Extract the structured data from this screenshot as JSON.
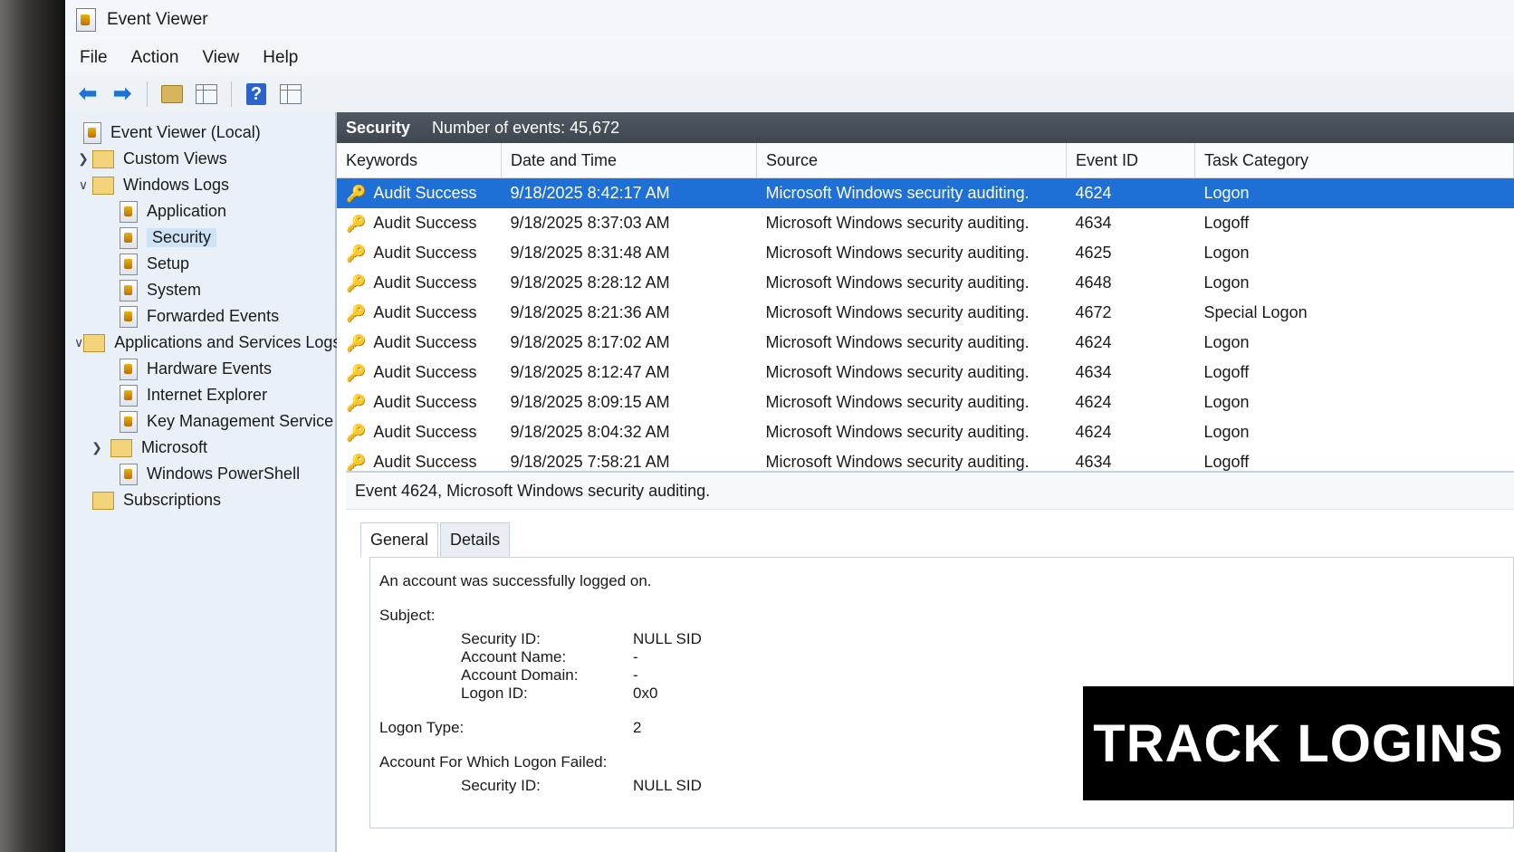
{
  "window": {
    "title": "Event Viewer"
  },
  "menu": [
    {
      "label": "File"
    },
    {
      "label": "Action"
    },
    {
      "label": "View"
    },
    {
      "label": "Help"
    }
  ],
  "sidebar": {
    "items": [
      {
        "label": "Event Viewer (Local)"
      },
      {
        "label": "Custom Views"
      },
      {
        "label": "Windows Logs"
      },
      {
        "label": "Application"
      },
      {
        "label": "Security"
      },
      {
        "label": "Setup"
      },
      {
        "label": "System"
      },
      {
        "label": "Forwarded Events"
      },
      {
        "label": "Applications and Services Logs"
      },
      {
        "label": "Hardware Events"
      },
      {
        "label": "Internet Explorer"
      },
      {
        "label": "Key Management Service"
      },
      {
        "label": "Microsoft"
      },
      {
        "label": "Windows PowerShell"
      },
      {
        "label": "Subscriptions"
      }
    ]
  },
  "log": {
    "name": "Security",
    "count_text": "Number of events: 45,672"
  },
  "table": {
    "columns": [
      "Keywords",
      "Date and Time",
      "Source",
      "Event ID",
      "Task Category"
    ],
    "rows": [
      {
        "keywords": "Audit Success",
        "datetime": "9/18/2025 8:42:17 AM",
        "source": "Microsoft Windows security auditing.",
        "event_id": "4624",
        "task": "Logon"
      },
      {
        "keywords": "Audit Success",
        "datetime": "9/18/2025 8:37:03 AM",
        "source": "Microsoft Windows security auditing.",
        "event_id": "4634",
        "task": "Logoff"
      },
      {
        "keywords": "Audit Success",
        "datetime": "9/18/2025 8:31:48 AM",
        "source": "Microsoft Windows security auditing.",
        "event_id": "4625",
        "task": "Logon"
      },
      {
        "keywords": "Audit Success",
        "datetime": "9/18/2025 8:28:12 AM",
        "source": "Microsoft Windows security auditing.",
        "event_id": "4648",
        "task": "Logon"
      },
      {
        "keywords": "Audit Success",
        "datetime": "9/18/2025 8:21:36 AM",
        "source": "Microsoft Windows security auditing.",
        "event_id": "4672",
        "task": "Special Logon"
      },
      {
        "keywords": "Audit Success",
        "datetime": "9/18/2025 8:17:02 AM",
        "source": "Microsoft Windows security auditing.",
        "event_id": "4624",
        "task": "Logon"
      },
      {
        "keywords": "Audit Success",
        "datetime": "9/18/2025 8:12:47 AM",
        "source": "Microsoft Windows security auditing.",
        "event_id": "4634",
        "task": "Logoff"
      },
      {
        "keywords": "Audit Success",
        "datetime": "9/18/2025 8:09:15 AM",
        "source": "Microsoft Windows security auditing.",
        "event_id": "4624",
        "task": "Logon"
      },
      {
        "keywords": "Audit Success",
        "datetime": "9/18/2025 8:04:32 AM",
        "source": "Microsoft Windows security auditing.",
        "event_id": "4624",
        "task": "Logon"
      },
      {
        "keywords": "Audit Success",
        "datetime": "9/18/2025 7:58:21 AM",
        "source": "Microsoft Windows security auditing.",
        "event_id": "4634",
        "task": "Logoff"
      }
    ]
  },
  "details": {
    "title": "Event 4624, Microsoft Windows security auditing.",
    "tabs": [
      {
        "label": "General"
      },
      {
        "label": "Details"
      }
    ],
    "message": "An account was successfully logged on.",
    "subject_label": "Subject:",
    "subject_fields": [
      {
        "k": "Security ID:",
        "v": "NULL SID"
      },
      {
        "k": "Account Name:",
        "v": "-"
      },
      {
        "k": "Account Domain:",
        "v": "-"
      },
      {
        "k": "Logon ID:",
        "v": "0x0"
      }
    ],
    "logon_type": {
      "k": "Logon Type:",
      "v": "2"
    },
    "failed_label": "Account For Which Logon Failed:",
    "failed_fields": [
      {
        "k": "Security ID:",
        "v": "NULL SID"
      }
    ]
  },
  "banner": {
    "text": "TRACK LOGINS"
  },
  "colors": {
    "selection": "#1e6fd6",
    "header_bar": "#4f5963",
    "banner_bg": "#000000"
  }
}
